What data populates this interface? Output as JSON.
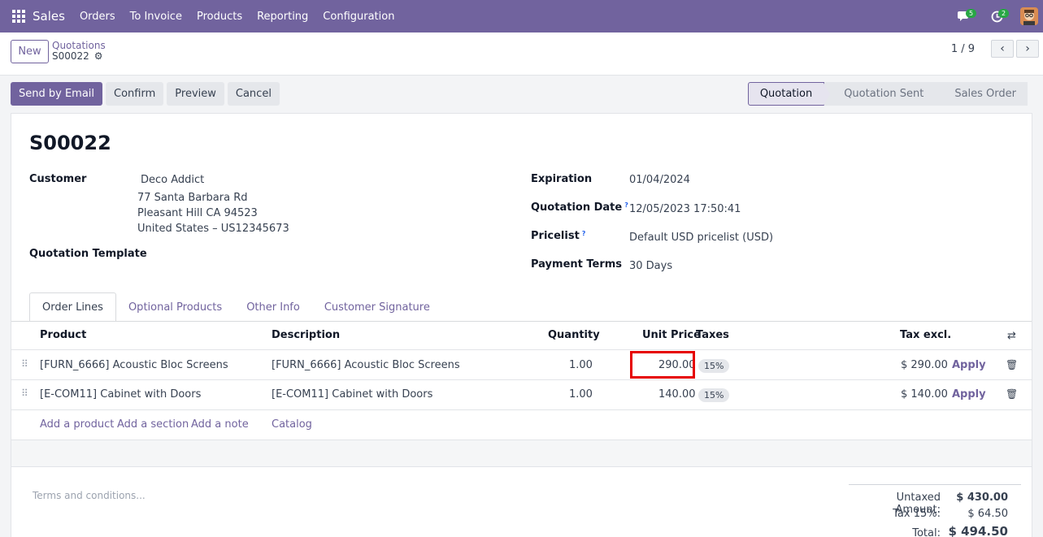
{
  "nav": {
    "app": "Sales",
    "menu": [
      "Orders",
      "To Invoice",
      "Products",
      "Reporting",
      "Configuration"
    ],
    "messages_count": "5",
    "activities_count": "2"
  },
  "control": {
    "new_label": "New",
    "breadcrumb_parent": "Quotations",
    "breadcrumb_record": "S00022",
    "pager": "1 / 9"
  },
  "actions": {
    "send_email": "Send by Email",
    "confirm": "Confirm",
    "preview": "Preview",
    "cancel": "Cancel"
  },
  "status": [
    "Quotation",
    "Quotation Sent",
    "Sales Order"
  ],
  "record": {
    "name": "S00022",
    "customer_label": "Customer",
    "customer_name": "Deco Addict",
    "customer_addr1": "77 Santa Barbara Rd",
    "customer_addr2": "Pleasant Hill CA 94523",
    "customer_addr3": "United States – US12345673",
    "template_label": "Quotation Template",
    "expiration_label": "Expiration",
    "expiration": "01/04/2024",
    "quotation_date_label": "Quotation Date",
    "quotation_date": "12/05/2023 17:50:41",
    "pricelist_label": "Pricelist",
    "pricelist": "Default USD pricelist (USD)",
    "payment_terms_label": "Payment Terms",
    "payment_terms": "30 Days"
  },
  "tabs": [
    "Order Lines",
    "Optional Products",
    "Other Info",
    "Customer Signature"
  ],
  "table": {
    "headers": {
      "product": "Product",
      "description": "Description",
      "quantity": "Quantity",
      "unit_price": "Unit Price",
      "taxes": "Taxes",
      "tax_excl": "Tax excl."
    },
    "rows": [
      {
        "product": "[FURN_6666] Acoustic Bloc Screens",
        "description": "[FURN_6666] Acoustic Bloc Screens",
        "quantity": "1.00",
        "unit_price": "290.00",
        "tax": "15%",
        "subtotal": "$ 290.00",
        "apply": "Apply"
      },
      {
        "product": "[E-COM11] Cabinet with Doors",
        "description": "[E-COM11] Cabinet with Doors",
        "quantity": "1.00",
        "unit_price": "140.00",
        "tax": "15%",
        "subtotal": "$ 140.00",
        "apply": "Apply"
      }
    ],
    "add_product": "Add a product",
    "add_section": "Add a section",
    "add_note": "Add a note",
    "catalog": "Catalog"
  },
  "footer": {
    "terms_placeholder": "Terms and conditions...",
    "untaxed_label": "Untaxed Amount:",
    "untaxed": "$ 430.00",
    "tax_label": "Tax 15%:",
    "tax": "$ 64.50",
    "total_label": "Total:",
    "total": "$ 494.50"
  },
  "colors": {
    "brand": "#71639e",
    "highlight": "#e60000"
  }
}
